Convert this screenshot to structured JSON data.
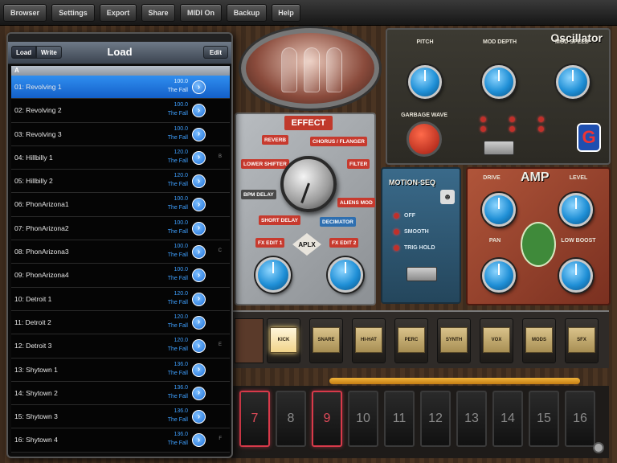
{
  "toolbar": {
    "buttons": [
      "Browser",
      "Settings",
      "Export",
      "Share",
      "MIDI On",
      "Backup",
      "Help"
    ]
  },
  "oscillator": {
    "title": "Oscillator",
    "pitch_label": "PITCH",
    "mod_depth_label": "MOD DEPTH",
    "mod_speed_label": "MOD SPEED",
    "garbage_wave_label": "GARBAGE WAVE"
  },
  "effect": {
    "title": "EFFECT",
    "tags": [
      "REVERB",
      "CHORUS / FLANGER",
      "LOWER SHIFTER",
      "FILTER",
      "BPM DELAY",
      "ALIENS MOD",
      "SHORT DELAY",
      "DECIMATOR",
      "FX EDIT 1",
      "FX EDIT 2"
    ],
    "logo": "APLX"
  },
  "motion_seq": {
    "title": "MOTION-SEQ",
    "options": [
      "OFF",
      "SMOOTH",
      "TRIG HOLD"
    ]
  },
  "amp": {
    "title": "AMP",
    "labels": [
      "DRIVE",
      "LEVEL",
      "PAN",
      "LOW BOOST"
    ]
  },
  "pads": [
    "KICK",
    "SNARE",
    "HI-HAT",
    "PERC",
    "SYNTH",
    "VOX",
    "MODS",
    "SFX"
  ],
  "steps": [
    "7",
    "8",
    "9",
    "10",
    "11",
    "12",
    "13",
    "14",
    "15",
    "16"
  ],
  "load_panel": {
    "status_left": "",
    "status_right": "",
    "load_tab": "Load",
    "write_tab": "Write",
    "title": "Load",
    "edit_button": "Edit",
    "section_letter": "A",
    "rows": [
      {
        "name": "01: Revolving 1",
        "bpm": "100.0",
        "author": "The Fall",
        "index": ""
      },
      {
        "name": "02: Revolving 2",
        "bpm": "100.0",
        "author": "The Fall",
        "index": ""
      },
      {
        "name": "03: Revolving 3",
        "bpm": "100.0",
        "author": "The Fall",
        "index": ""
      },
      {
        "name": "04: Hillbilly 1",
        "bpm": "120.0",
        "author": "The Fall",
        "index": "B"
      },
      {
        "name": "05: Hillbilly 2",
        "bpm": "120.0",
        "author": "The Fall",
        "index": ""
      },
      {
        "name": "06: PhonArizona1",
        "bpm": "100.0",
        "author": "The Fall",
        "index": ""
      },
      {
        "name": "07: PhonArizona2",
        "bpm": "100.0",
        "author": "The Fall",
        "index": ""
      },
      {
        "name": "08: PhonArizona3",
        "bpm": "100.0",
        "author": "The Fall",
        "index": "C"
      },
      {
        "name": "09: PhonArizona4",
        "bpm": "100.0",
        "author": "The Fall",
        "index": ""
      },
      {
        "name": "10: Detroit 1",
        "bpm": "120.0",
        "author": "The Fall",
        "index": ""
      },
      {
        "name": "11: Detroit 2",
        "bpm": "120.0",
        "author": "The Fall",
        "index": ""
      },
      {
        "name": "12: Detroit 3",
        "bpm": "120.0",
        "author": "The Fall",
        "index": "E"
      },
      {
        "name": "13: Shytown 1",
        "bpm": "136.0",
        "author": "The Fall",
        "index": ""
      },
      {
        "name": "14: Shytown 2",
        "bpm": "136.0",
        "author": "The Fall",
        "index": ""
      },
      {
        "name": "15: Shytown 3",
        "bpm": "136.0",
        "author": "The Fall",
        "index": ""
      },
      {
        "name": "16: Shytown 4",
        "bpm": "136.0",
        "author": "The Fall",
        "index": "F"
      }
    ],
    "selected_index": 0
  },
  "colors": {
    "selected_row": "#1e78e0",
    "step_active": "#d83a4a",
    "knob_blue": "#1f8fd6"
  }
}
